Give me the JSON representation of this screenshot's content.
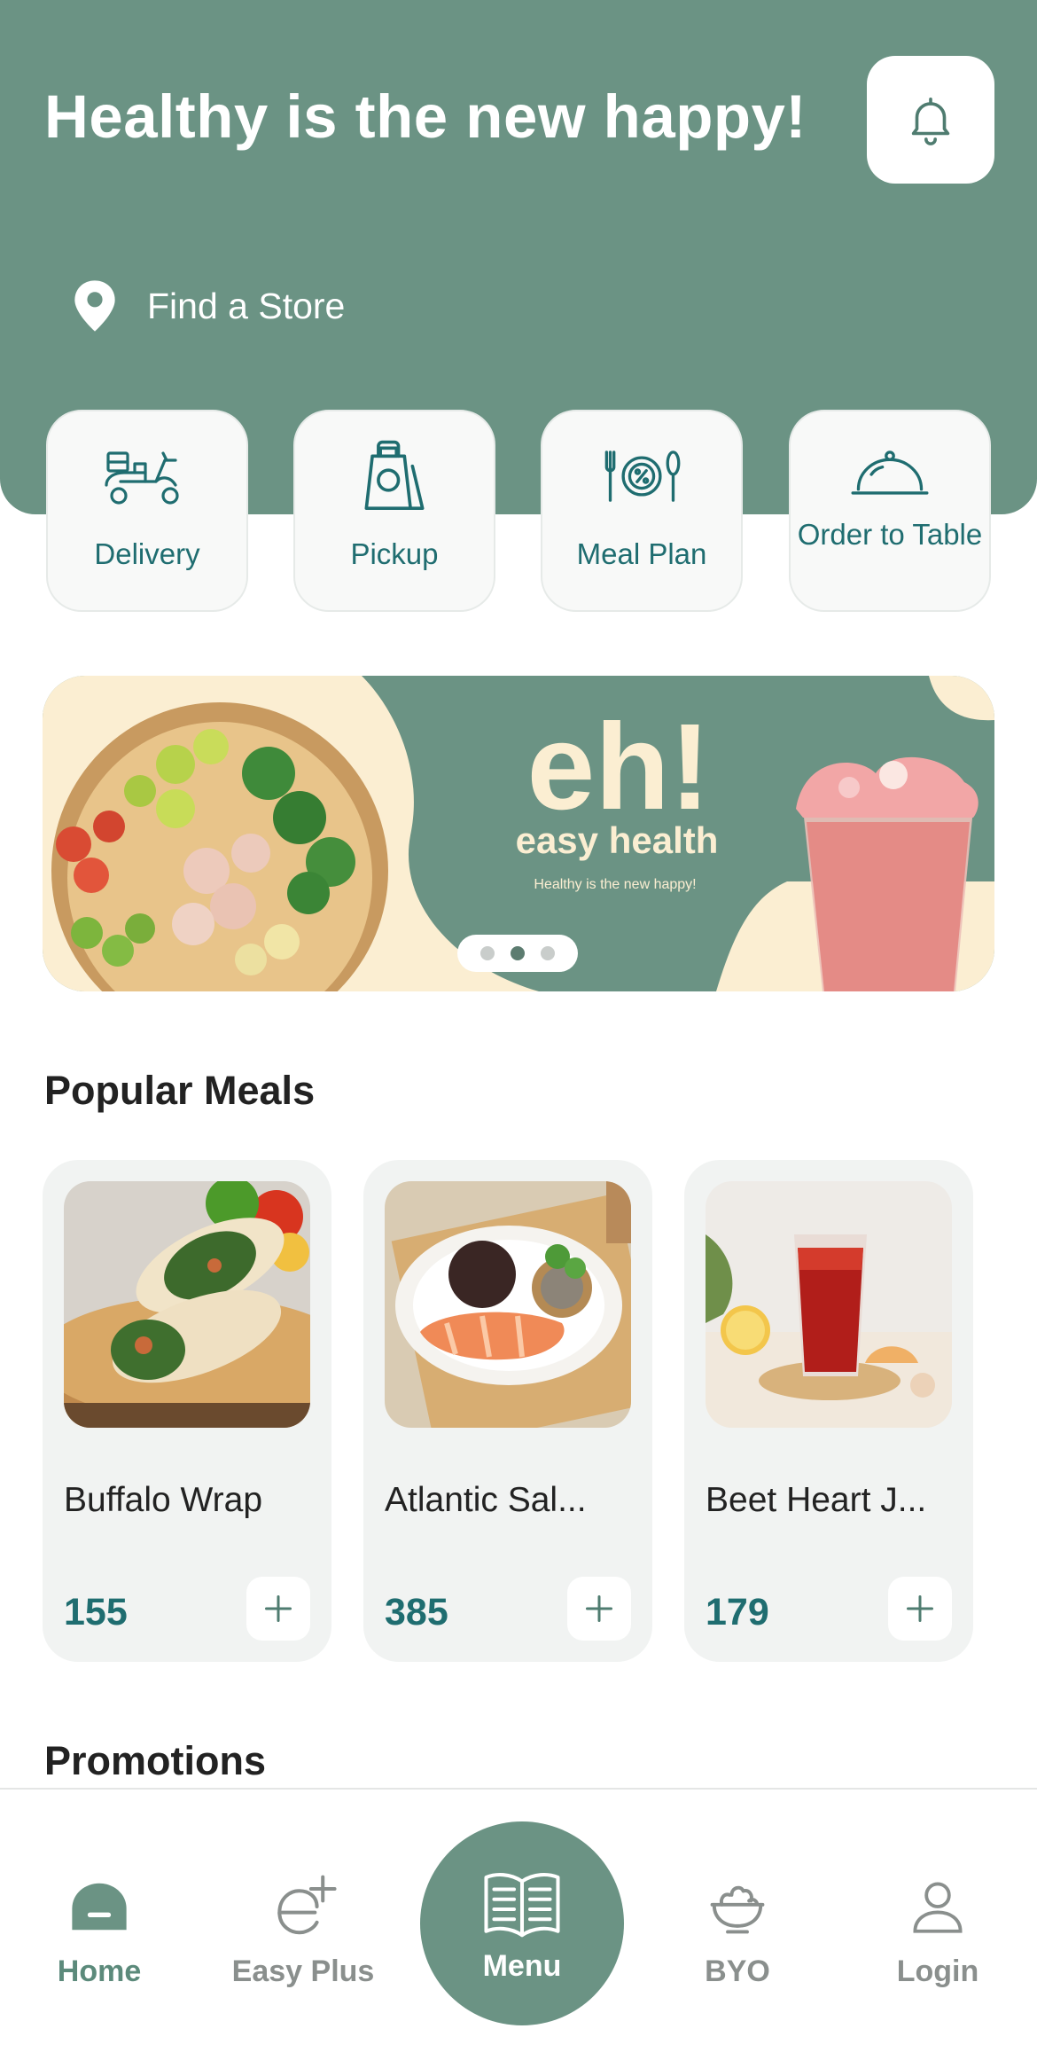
{
  "header": {
    "title": "Healthy is the new happy!",
    "store_label": "Find a Store"
  },
  "services": [
    {
      "label": "Delivery",
      "icon": "scooter-icon"
    },
    {
      "label": "Pickup",
      "icon": "bag-icon"
    },
    {
      "label": "Meal Plan",
      "icon": "plate-cutlery-icon"
    },
    {
      "label": "Order to Table",
      "icon": "cloche-icon"
    }
  ],
  "banner": {
    "brand": "eh!",
    "brand_sub": "easy health",
    "tagline": "Healthy is the new happy!",
    "carousel_total": 3,
    "carousel_active": 2
  },
  "sections": {
    "popular": "Popular Meals",
    "promotions": "Promotions"
  },
  "meals": [
    {
      "name": "Buffalo Wrap",
      "price": "155"
    },
    {
      "name": "Atlantic Sal...",
      "price": "385"
    },
    {
      "name": "Beet Heart J...",
      "price": "179"
    }
  ],
  "nav": {
    "home": "Home",
    "easy_plus": "Easy Plus",
    "menu": "Menu",
    "byo": "BYO",
    "login": "Login"
  },
  "colors": {
    "brand_green": "#6b9384",
    "accent_teal": "#1f6d70",
    "cream": "#fbeed2"
  }
}
